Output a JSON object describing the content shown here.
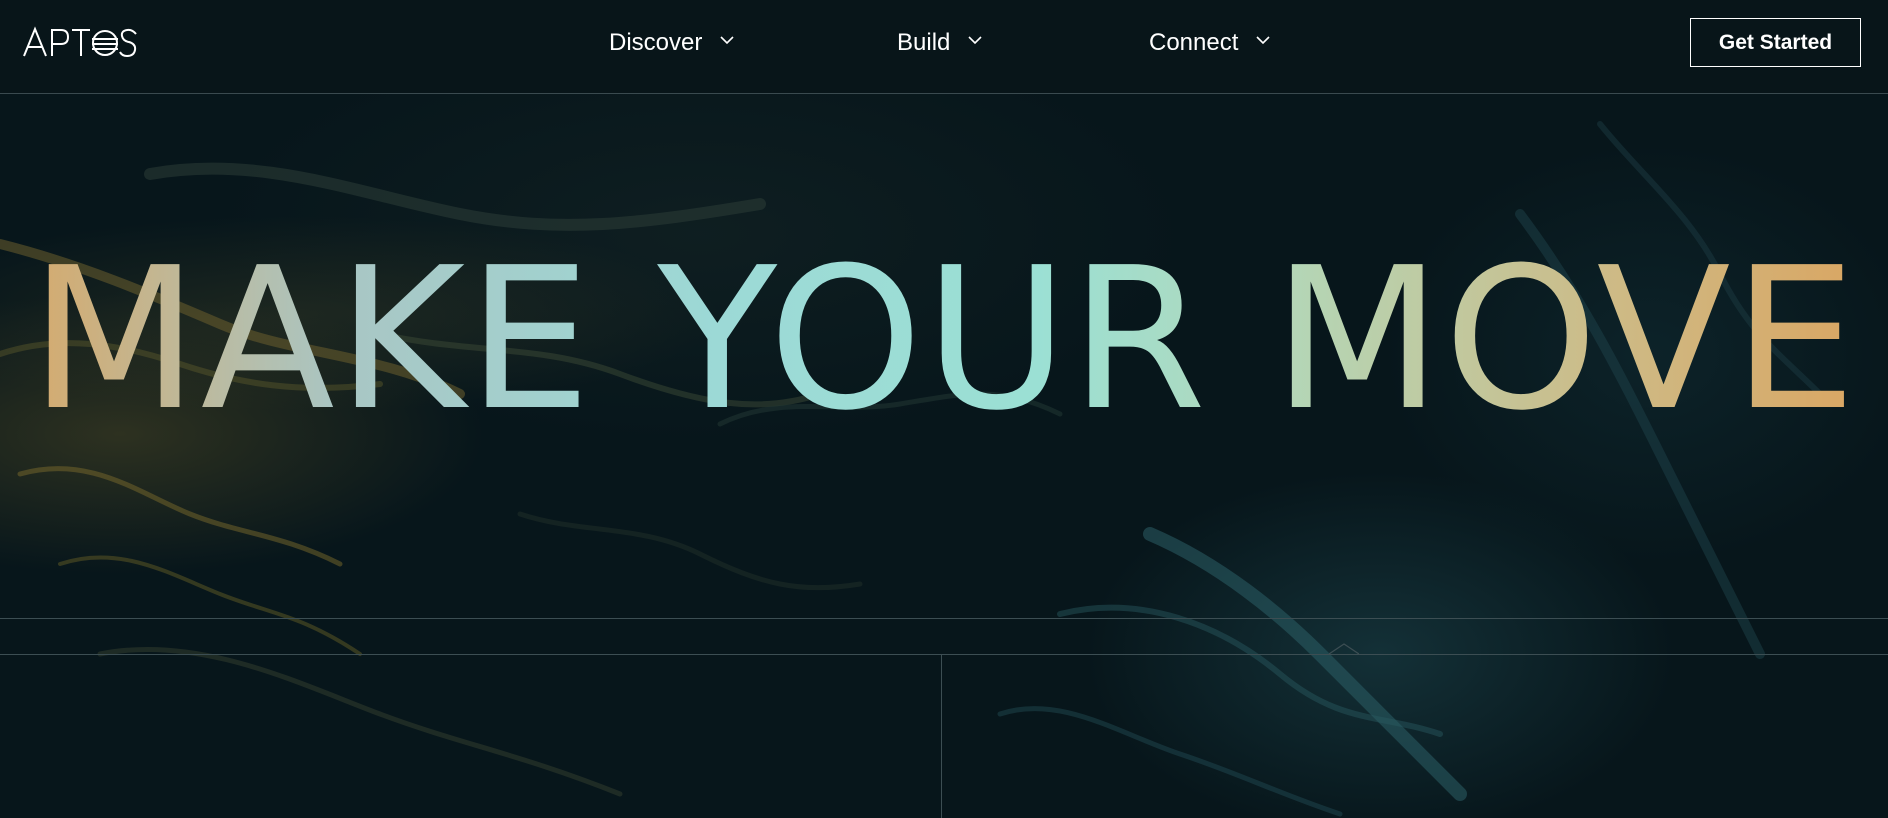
{
  "header": {
    "logo": {
      "text": "APTOS",
      "icon": "aptos-logo-icon"
    },
    "nav": [
      {
        "label": "Discover",
        "icon": "chevron-down-icon"
      },
      {
        "label": "Build",
        "icon": "chevron-down-icon"
      },
      {
        "label": "Connect",
        "icon": "chevron-down-icon"
      }
    ],
    "cta_label": "Get Started"
  },
  "hero": {
    "headline": "MAKE YOUR MOVE",
    "headline_gradient": [
      "#d9a866",
      "#9cd9d6",
      "#9be0d4",
      "#dba45f"
    ],
    "background_color": "#07161b"
  },
  "colors": {
    "header_bg": "#081519",
    "divider": "#3c4e53",
    "text": "#ffffff"
  }
}
